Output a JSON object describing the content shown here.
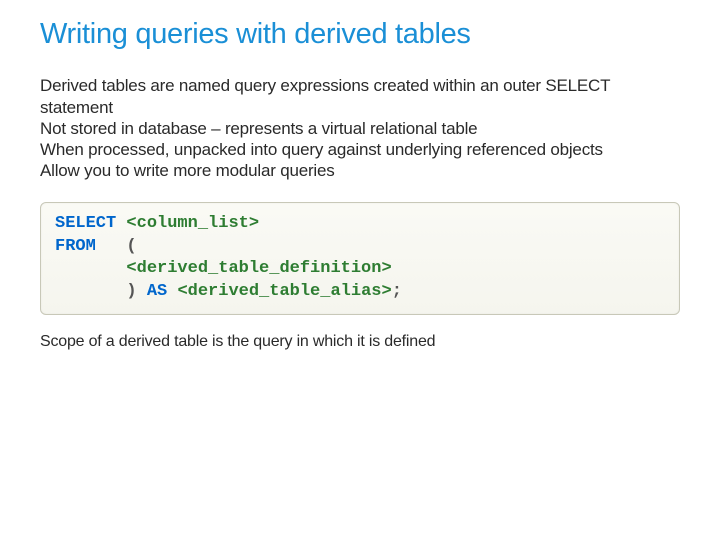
{
  "title": "Writing queries with derived tables",
  "bullets": {
    "b1": "Derived tables are named query expressions created within an outer SELECT statement",
    "b2": "Not stored in database – represents a virtual relational table",
    "b3": "When processed, unpacked into query against underlying referenced objects",
    "b4": "Allow you to write more modular queries"
  },
  "code": {
    "kw_select": "SELECT",
    "ph_column_list": "<column_list>",
    "kw_from": "FROM",
    "paren_open": "(",
    "ph_derived_def": "<derived_table_definition>",
    "paren_close": ")",
    "kw_as": "AS",
    "ph_alias": "<derived_table_alias>",
    "semicolon": ";"
  },
  "footer": "Scope of a derived table is the query in which it is defined"
}
